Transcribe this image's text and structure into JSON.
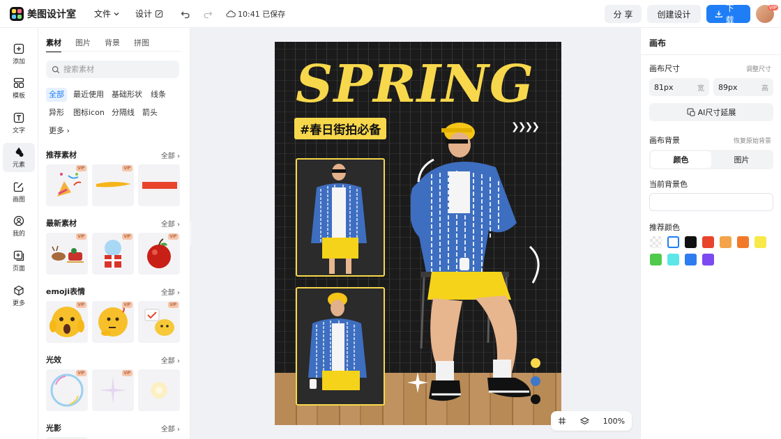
{
  "app": {
    "name": "美图设计室"
  },
  "menu": {
    "file": "文件",
    "design": "设计",
    "save_status": "10:41 已保存"
  },
  "actions": {
    "share": "分 享",
    "create": "创建设计",
    "download": "下载"
  },
  "user": {
    "vip_badge": "VIP"
  },
  "rail": [
    {
      "label": "添加",
      "icon": "plus-square-icon"
    },
    {
      "label": "模板",
      "icon": "template-icon"
    },
    {
      "label": "文字",
      "icon": "text-icon"
    },
    {
      "label": "元素",
      "icon": "element-icon"
    },
    {
      "label": "画图",
      "icon": "draw-icon"
    },
    {
      "label": "我的",
      "icon": "user-icon"
    },
    {
      "label": "页面",
      "icon": "page-add-icon"
    },
    {
      "label": "更多",
      "icon": "cube-icon"
    }
  ],
  "assets": {
    "tabs": [
      "素材",
      "图片",
      "背景",
      "拼图"
    ],
    "search_placeholder": "搜索素材",
    "chips": [
      "全部",
      "最近使用",
      "基础形状",
      "线条",
      "异形",
      "图标icon",
      "分隔线",
      "箭头",
      "更多"
    ],
    "all_label": "全部",
    "vip": "VIP",
    "sections": [
      "推荐素材",
      "最新素材",
      "emoji表情",
      "光效",
      "光影"
    ]
  },
  "poster": {
    "headline": "SPRING",
    "tagline": "#春日街拍必备",
    "arrows": "❯❯❯❯",
    "dot_colors": [
      "#f7d84c",
      "#3f78c9",
      "#111111"
    ]
  },
  "canvas_tools": {
    "zoom": "100%"
  },
  "props": {
    "title": "画布",
    "size_label": "画布尺寸",
    "size_link": "调整尺寸",
    "width_value": "81px",
    "width_unit": "宽",
    "height_value": "89px",
    "height_unit": "高",
    "ai_extend": "AI尺寸延展",
    "bg_label": "画布背景",
    "bg_link": "恢复原始背景",
    "seg_color": "颜色",
    "seg_image": "图片",
    "current_bg": "当前背景色",
    "recommend": "推荐颜色",
    "swatches": [
      "transparent",
      "#ffffff",
      "#111111",
      "#e8442c",
      "#f3a448",
      "#f07a2a",
      "#f7e94a",
      "#4fca4a",
      "#5ce6e8",
      "#2f7cf0",
      "#7c4af0"
    ]
  }
}
